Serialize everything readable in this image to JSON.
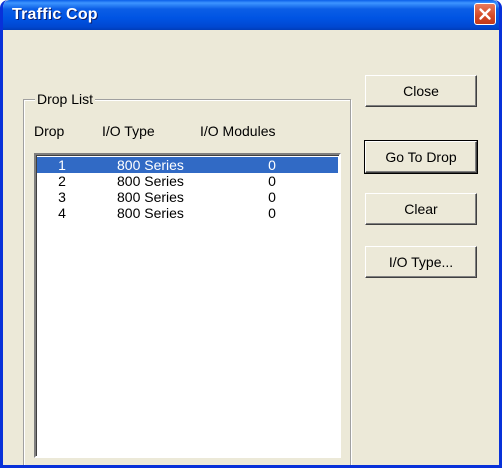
{
  "window": {
    "title": "Traffic Cop"
  },
  "group": {
    "label": "Drop List"
  },
  "columns": {
    "drop": "Drop",
    "io_type": "I/O Type",
    "io_modules": "I/O Modules"
  },
  "rows": [
    {
      "drop": "1",
      "io_type": "800 Series",
      "io_modules": "0",
      "selected": true
    },
    {
      "drop": "2",
      "io_type": "800 Series",
      "io_modules": "0",
      "selected": false
    },
    {
      "drop": "3",
      "io_type": "800 Series",
      "io_modules": "0",
      "selected": false
    },
    {
      "drop": "4",
      "io_type": "800 Series",
      "io_modules": "0",
      "selected": false
    }
  ],
  "buttons": {
    "close": "Close",
    "go_to_drop": "Go To Drop",
    "clear": "Clear",
    "io_type": "I/O Type..."
  },
  "colors": {
    "titlebar": "#0054e3",
    "selection": "#316ac5",
    "dialog_bg": "#ece9d8",
    "close_button": "#d34a26"
  }
}
